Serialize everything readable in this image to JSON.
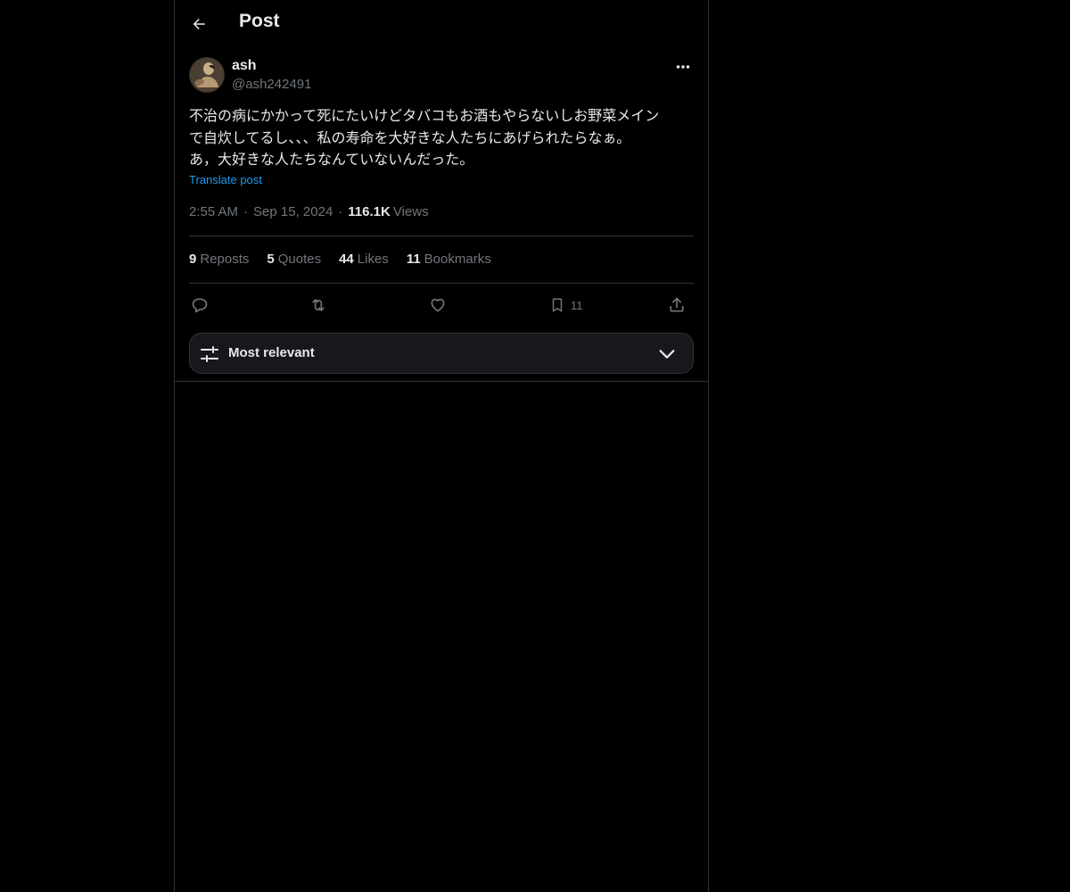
{
  "header": {
    "title": "Post",
    "back_icon": "arrow-left-icon"
  },
  "author": {
    "name": "ash",
    "handle": "@ash242491",
    "avatar": "avatar-image",
    "more_icon": "more-horizontal-icon"
  },
  "post": {
    "text": "不治の病にかかって死にたいけどタバコもお酒もやらないしお野菜メイン\nで自炊してるし、、、私の寿命を大好きな人たちにあげられたらなぁ。\nあ，大好きな人たちなんていないんだった。",
    "translate_label": "Translate post",
    "time": "2:55 AM",
    "date": "Sep 15, 2024",
    "separator": "·",
    "views_count": "116.1K",
    "views_label": "Views"
  },
  "stats": [
    {
      "count": "9",
      "label": "Reposts"
    },
    {
      "count": "5",
      "label": "Quotes"
    },
    {
      "count": "44",
      "label": "Likes"
    },
    {
      "count": "11",
      "label": "Bookmarks"
    }
  ],
  "actions": {
    "reply_icon": "reply-icon",
    "repost_icon": "repost-icon",
    "like_icon": "heart-icon",
    "bookmark_icon": "bookmark-icon",
    "bookmark_count": "11",
    "share_icon": "share-icon"
  },
  "sort": {
    "label": "Most relevant",
    "icon": "filter-sliders-icon",
    "chevron": "chevron-down-icon"
  },
  "colors": {
    "background": "#000000",
    "text_primary": "#e7e9ea",
    "text_secondary": "#71767b",
    "accent": "#1d9bf0",
    "border": "#2f3336"
  }
}
